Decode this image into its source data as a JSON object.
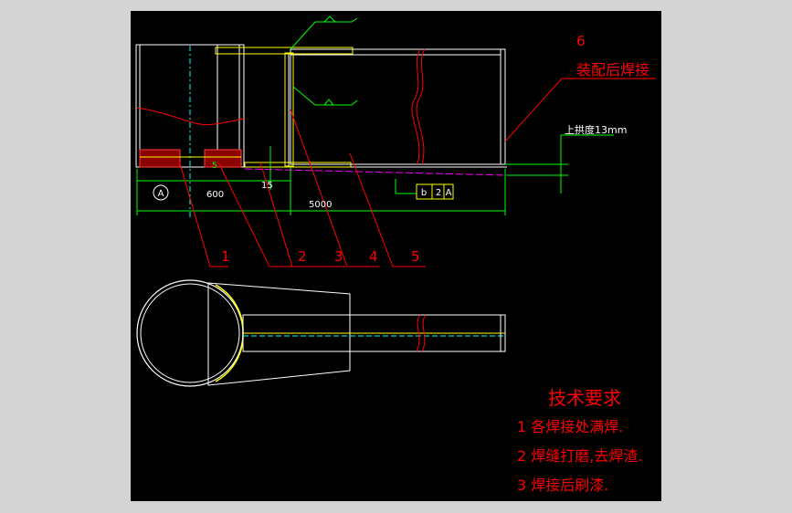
{
  "labels": {
    "part1": "1",
    "part2": "2",
    "part3": "3",
    "part4": "4",
    "part5": "5",
    "part6": "6",
    "assembly_weld": "装配后焊接",
    "camber": "上拱度13mm",
    "dim_600": "600",
    "dim_5000": "5000",
    "dim_15": "15",
    "dim_5": "5",
    "datum_a": "A",
    "tol_symbol": "b",
    "tol_value": "2",
    "tol_datum": "A"
  },
  "requirements": {
    "title": "技术要求",
    "items": [
      "1 各焊接处满焊.",
      "2 焊缝打磨,去焊渣.",
      "3 焊接后刷漆."
    ]
  },
  "colors": {
    "background": "#000000",
    "frame": "#d4d4d4",
    "outline": "#ffffff",
    "leader": "#ff0000",
    "dimension": "#00ff00",
    "weld": "#ffff00",
    "centerline": "#ff00ff"
  }
}
